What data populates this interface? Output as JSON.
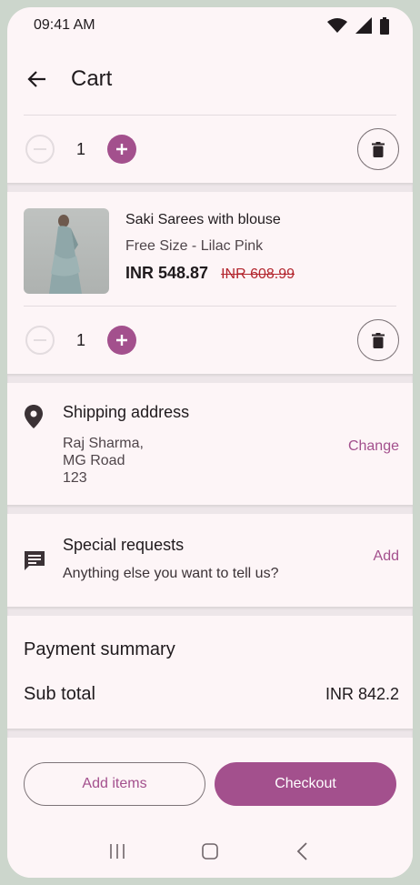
{
  "status": {
    "time": "09:41 AM"
  },
  "appbar": {
    "title": "Cart"
  },
  "cart_items": [
    {
      "quantity": "1"
    },
    {
      "name": "Saki Sarees with blouse",
      "variant": "Free Size - Lilac Pink",
      "price": "INR 548.87",
      "original_price": "INR 608.99",
      "quantity": "1"
    }
  ],
  "shipping": {
    "title": "Shipping address",
    "lines": [
      "Raj Sharma,",
      "MG Road",
      "123"
    ],
    "action": "Change"
  },
  "special": {
    "title": "Special requests",
    "subtitle": "Anything else you want to tell us?",
    "action": "Add"
  },
  "payment": {
    "title": "Payment summary",
    "subtotal_label": "Sub total",
    "subtotal_value": "INR 842.2"
  },
  "buttons": {
    "add_items": "Add items",
    "checkout": "Checkout"
  },
  "colors": {
    "accent": "#a3508d",
    "background": "#fdf5f7",
    "strike_price": "#b3262e"
  }
}
